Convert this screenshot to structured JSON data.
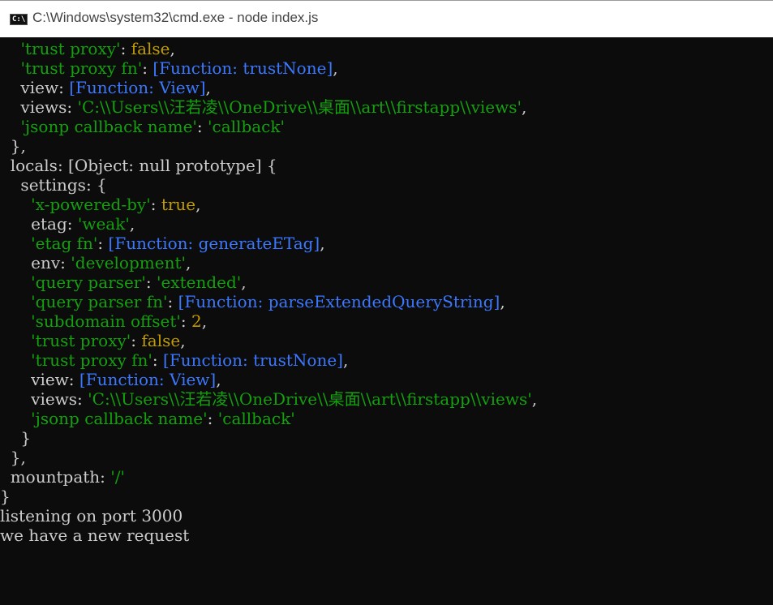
{
  "window": {
    "title": "C:\\Windows\\system32\\cmd.exe - node  index.js",
    "icon": "cmd-icon",
    "icon_text": "C:\\"
  },
  "colors": {
    "background": "#0c0c0c",
    "text": "#cccccc",
    "string": "#13a10e",
    "boolean_number": "#c19c00",
    "function": "#3b78ff"
  },
  "lines": [
    [
      {
        "t": "    ",
        "c": "plain"
      },
      {
        "t": "'trust proxy'",
        "c": "str"
      },
      {
        "t": ": ",
        "c": "plain"
      },
      {
        "t": "false",
        "c": "bool"
      },
      {
        "t": ",",
        "c": "plain"
      }
    ],
    [
      {
        "t": "    ",
        "c": "plain"
      },
      {
        "t": "'trust proxy fn'",
        "c": "str"
      },
      {
        "t": ": ",
        "c": "plain"
      },
      {
        "t": "[Function: trustNone]",
        "c": "func"
      },
      {
        "t": ",",
        "c": "plain"
      }
    ],
    [
      {
        "t": "    view: ",
        "c": "plain"
      },
      {
        "t": "[Function: View]",
        "c": "func"
      },
      {
        "t": ",",
        "c": "plain"
      }
    ],
    [
      {
        "t": "    views: ",
        "c": "plain"
      },
      {
        "t": "'C:\\\\Users\\\\汪若凌\\\\OneDrive\\\\桌面\\\\art\\\\firstapp\\\\views'",
        "c": "str"
      },
      {
        "t": ",",
        "c": "plain"
      }
    ],
    [
      {
        "t": "    ",
        "c": "plain"
      },
      {
        "t": "'jsonp callback name'",
        "c": "str"
      },
      {
        "t": ": ",
        "c": "plain"
      },
      {
        "t": "'callback'",
        "c": "str"
      }
    ],
    [
      {
        "t": "  },",
        "c": "plain"
      }
    ],
    [
      {
        "t": "  locals: [Object: null prototype] {",
        "c": "plain"
      }
    ],
    [
      {
        "t": "    settings: {",
        "c": "plain"
      }
    ],
    [
      {
        "t": "      ",
        "c": "plain"
      },
      {
        "t": "'x-powered-by'",
        "c": "str"
      },
      {
        "t": ": ",
        "c": "plain"
      },
      {
        "t": "true",
        "c": "bool"
      },
      {
        "t": ",",
        "c": "plain"
      }
    ],
    [
      {
        "t": "      etag: ",
        "c": "plain"
      },
      {
        "t": "'weak'",
        "c": "str"
      },
      {
        "t": ",",
        "c": "plain"
      }
    ],
    [
      {
        "t": "      ",
        "c": "plain"
      },
      {
        "t": "'etag fn'",
        "c": "str"
      },
      {
        "t": ": ",
        "c": "plain"
      },
      {
        "t": "[Function: generateETag]",
        "c": "func"
      },
      {
        "t": ",",
        "c": "plain"
      }
    ],
    [
      {
        "t": "      env: ",
        "c": "plain"
      },
      {
        "t": "'development'",
        "c": "str"
      },
      {
        "t": ",",
        "c": "plain"
      }
    ],
    [
      {
        "t": "      ",
        "c": "plain"
      },
      {
        "t": "'query parser'",
        "c": "str"
      },
      {
        "t": ": ",
        "c": "plain"
      },
      {
        "t": "'extended'",
        "c": "str"
      },
      {
        "t": ",",
        "c": "plain"
      }
    ],
    [
      {
        "t": "      ",
        "c": "plain"
      },
      {
        "t": "'query parser fn'",
        "c": "str"
      },
      {
        "t": ": ",
        "c": "plain"
      },
      {
        "t": "[Function: parseExtendedQueryString]",
        "c": "func"
      },
      {
        "t": ",",
        "c": "plain"
      }
    ],
    [
      {
        "t": "      ",
        "c": "plain"
      },
      {
        "t": "'subdomain offset'",
        "c": "str"
      },
      {
        "t": ": ",
        "c": "plain"
      },
      {
        "t": "2",
        "c": "num"
      },
      {
        "t": ",",
        "c": "plain"
      }
    ],
    [
      {
        "t": "      ",
        "c": "plain"
      },
      {
        "t": "'trust proxy'",
        "c": "str"
      },
      {
        "t": ": ",
        "c": "plain"
      },
      {
        "t": "false",
        "c": "bool"
      },
      {
        "t": ",",
        "c": "plain"
      }
    ],
    [
      {
        "t": "      ",
        "c": "plain"
      },
      {
        "t": "'trust proxy fn'",
        "c": "str"
      },
      {
        "t": ": ",
        "c": "plain"
      },
      {
        "t": "[Function: trustNone]",
        "c": "func"
      },
      {
        "t": ",",
        "c": "plain"
      }
    ],
    [
      {
        "t": "      view: ",
        "c": "plain"
      },
      {
        "t": "[Function: View]",
        "c": "func"
      },
      {
        "t": ",",
        "c": "plain"
      }
    ],
    [
      {
        "t": "      views: ",
        "c": "plain"
      },
      {
        "t": "'C:\\\\Users\\\\汪若凌\\\\OneDrive\\\\桌面\\\\art\\\\firstapp\\\\views'",
        "c": "str"
      },
      {
        "t": ",",
        "c": "plain"
      }
    ],
    [
      {
        "t": "      ",
        "c": "plain"
      },
      {
        "t": "'jsonp callback name'",
        "c": "str"
      },
      {
        "t": ": ",
        "c": "plain"
      },
      {
        "t": "'callback'",
        "c": "str"
      }
    ],
    [
      {
        "t": "    }",
        "c": "plain"
      }
    ],
    [
      {
        "t": "  },",
        "c": "plain"
      }
    ],
    [
      {
        "t": "  mountpath: ",
        "c": "plain"
      },
      {
        "t": "'/'",
        "c": "str"
      }
    ],
    [
      {
        "t": "}",
        "c": "plain"
      }
    ],
    [
      {
        "t": "listening on port 3000",
        "c": "plain"
      }
    ],
    [
      {
        "t": "we have a new request",
        "c": "plain"
      }
    ]
  ]
}
